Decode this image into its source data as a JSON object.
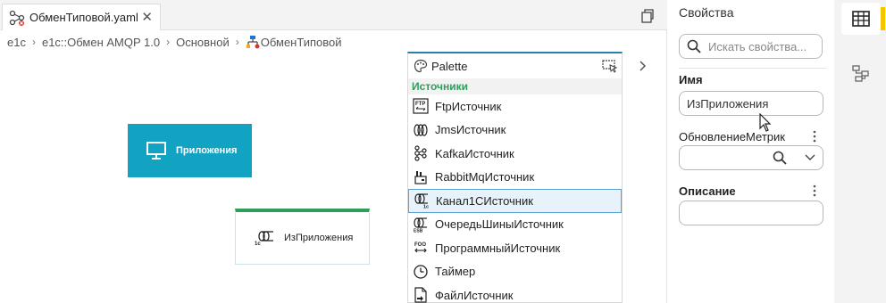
{
  "editor": {
    "tab": {
      "label": "ОбменТиповой.yaml",
      "close": "✕"
    },
    "breadcrumb": [
      "e1c",
      "e1c::Обмен AMQP 1.0",
      "Основной",
      "ОбменТиповой"
    ],
    "nodes": {
      "app": {
        "label": "Приложения"
      },
      "source": {
        "label": "ИзПриложения"
      }
    }
  },
  "palette": {
    "title": "Palette",
    "section": "Источники",
    "items": [
      {
        "label": "FtpИсточник",
        "icon": "ftp-icon"
      },
      {
        "label": "JmsИсточник",
        "icon": "jms-icon"
      },
      {
        "label": "KafkaИсточник",
        "icon": "kafka-icon"
      },
      {
        "label": "RabbitMqИсточник",
        "icon": "rabbitmq-icon"
      },
      {
        "label": "Канал1СИсточник",
        "icon": "channel-1c-icon",
        "selected": true
      },
      {
        "label": "ОчередьШиныИсточник",
        "icon": "esb-queue-icon"
      },
      {
        "label": "ПрограммныйИсточник",
        "icon": "program-source-icon"
      },
      {
        "label": "Таймер",
        "icon": "timer-icon"
      },
      {
        "label": "ФайлИсточник",
        "icon": "file-source-icon"
      }
    ]
  },
  "properties": {
    "title": "Свойства",
    "search_placeholder": "Искать свойства...",
    "name_label": "Имя",
    "name_value": "ИзПриложения",
    "metrics_label": "ОбновлениеМетрик",
    "metrics_value": "",
    "description_label": "Описание",
    "description_value": ""
  },
  "colors": {
    "app_node": "#12a2c2",
    "source_node_top": "#2f9e5b",
    "section_green": "#2f9e5b",
    "accent_yellow": "#f5c400",
    "selection_blue": "#5aa0d0"
  }
}
